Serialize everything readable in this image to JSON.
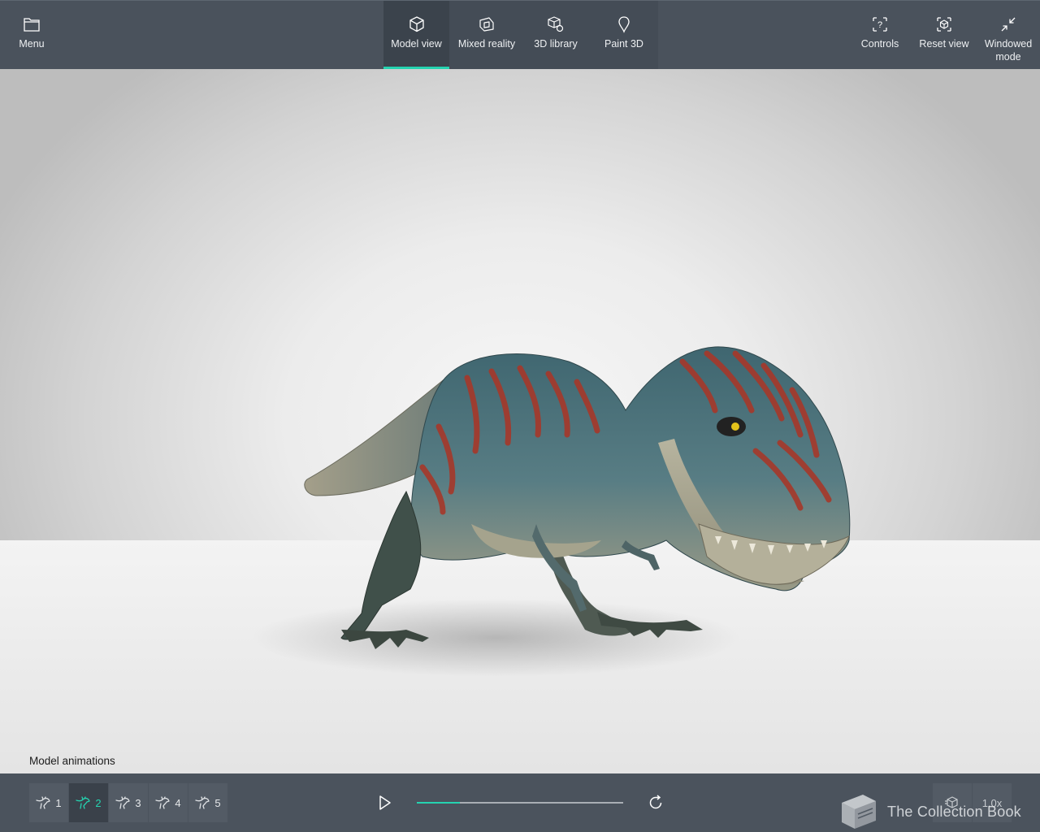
{
  "topbar": {
    "menu_label": "Menu",
    "tabs": [
      {
        "label": "Model view",
        "icon": "cube-icon",
        "active": true
      },
      {
        "label": "Mixed reality",
        "icon": "mixed-reality-icon",
        "active": false
      },
      {
        "label": "3D library",
        "icon": "library-icon",
        "active": false
      },
      {
        "label": "Paint 3D",
        "icon": "paint3d-icon",
        "active": false
      }
    ],
    "controls_label": "Controls",
    "reset_view_label": "Reset view",
    "windowed_line1": "Windowed",
    "windowed_line2": "mode"
  },
  "viewport": {
    "animations_title": "Model animations"
  },
  "animations": {
    "items": [
      "1",
      "2",
      "3",
      "4",
      "5"
    ],
    "active_index": 1,
    "progress": 0.21
  },
  "bottom_right": {
    "speed_label": "1.0x"
  },
  "watermark": {
    "text": "The Collection Book"
  },
  "colors": {
    "accent": "#25d3b0",
    "bar": "#4a525c"
  }
}
